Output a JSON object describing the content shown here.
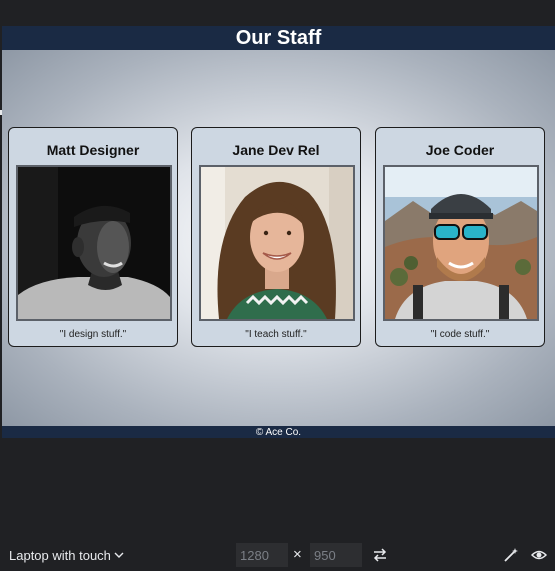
{
  "site": {
    "title": "Our Staff",
    "footer": "© Ace Co.",
    "colors": {
      "header_footer": "#1a2a44",
      "card_bg": "#cdd7e2"
    }
  },
  "staff": [
    {
      "name": "Matt Designer",
      "quote": "\"I design stuff.\"",
      "photo": "grayscale portrait of smiling man with backwards cap"
    },
    {
      "name": "Jane Dev Rel",
      "quote": "\"I teach stuff.\"",
      "photo": "portrait of smiling woman with curly brown hair"
    },
    {
      "name": "Joe Coder",
      "quote": "\"I code stuff.\"",
      "photo": "selfie of man with cap and sunglasses in mountains"
    }
  ],
  "devtools": {
    "device": "Laptop with touch",
    "width": "1280",
    "height": "950",
    "icons": [
      "chevron-down-icon",
      "swap-dimensions-icon",
      "magic-wand-icon",
      "eye-icon"
    ]
  }
}
